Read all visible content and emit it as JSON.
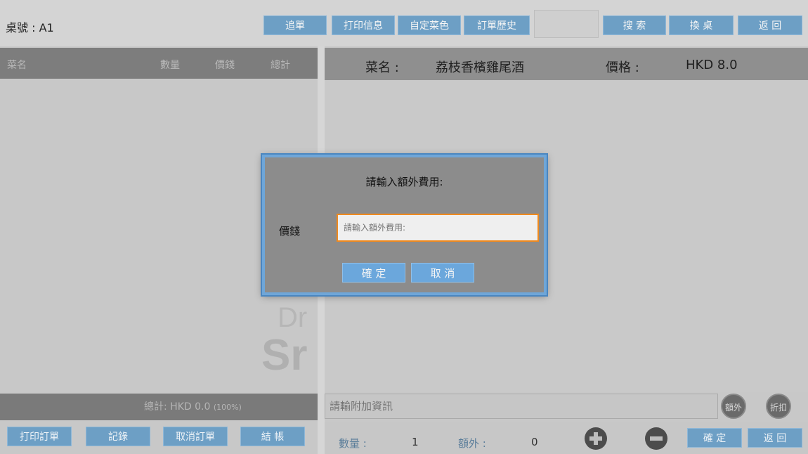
{
  "topbar": {
    "table_label": "桌號 :  A1",
    "buttons": {
      "add_order": "追單",
      "print_info": "打印信息",
      "custom_dish": "自定菜色",
      "order_history": "訂單歷史",
      "search": "搜 索",
      "change_table": "換 桌",
      "back": "返 回"
    }
  },
  "left_panel": {
    "columns": [
      "菜名",
      "數量",
      "價錢",
      "總計"
    ],
    "watermark_line1": "Dr",
    "watermark_line2": "Sr",
    "total_text": "總計: HKD 0.0",
    "total_pct": "(100%)",
    "buttons": {
      "print_order": "打印訂單",
      "records": "記錄",
      "cancel_order": "取消訂單",
      "checkout": "結 帳"
    }
  },
  "right_panel": {
    "dish_label": "菜名 :",
    "dish_name": "荔枝香檳雞尾酒",
    "price_label": "價格 :",
    "price_value": "HKD 8.0",
    "note_placeholder": "請輸附加資訊",
    "extra_button": "額外",
    "discount_button": "折扣",
    "quantity_label": "數量 :",
    "quantity_value": "1",
    "extra_label": "額外 :",
    "extra_value": "0",
    "confirm": "確 定",
    "back": "返 回"
  },
  "dialog": {
    "title": "請輸入額外費用:",
    "field_label": "價錢",
    "placeholder": "請輸入額外費用:",
    "confirm": "確 定",
    "cancel": "取 消"
  },
  "colors": {
    "button_blue": "#6d9fc5",
    "dialog_border": "#6fa6d8",
    "input_focus": "#f08a1e"
  }
}
